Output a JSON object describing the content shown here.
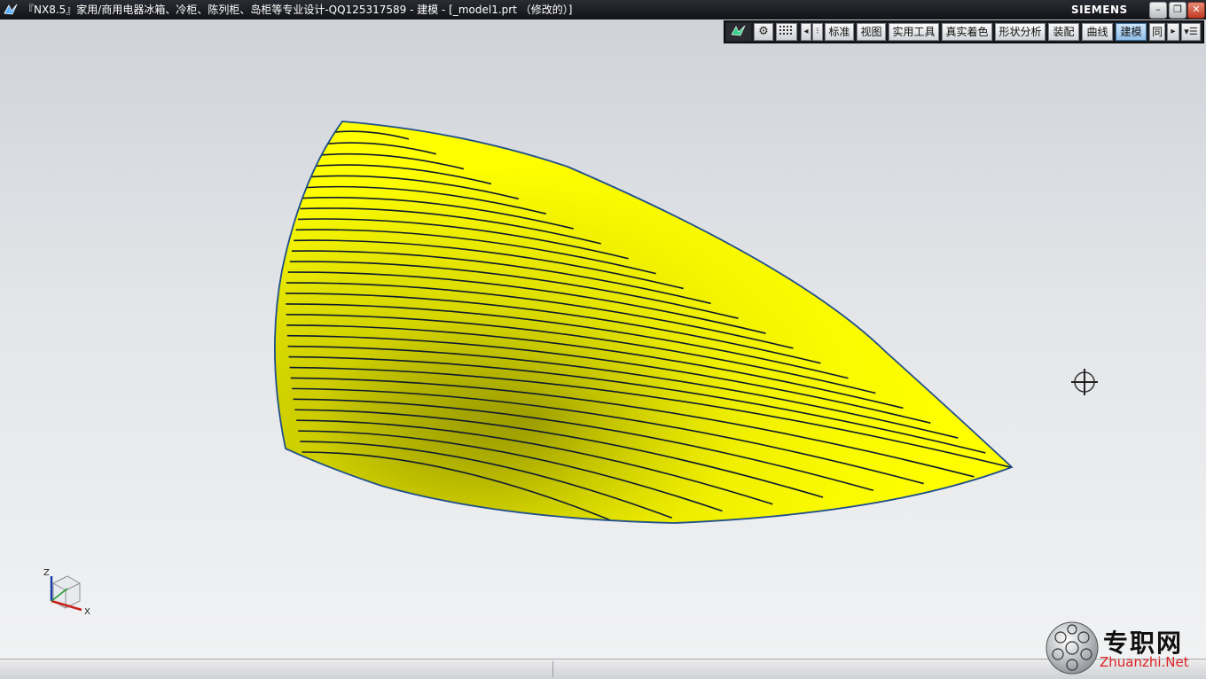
{
  "window": {
    "title": "『NX8.5』家用/商用电器冰箱、冷柜、陈列柜、岛柜等专业设计-QQ125317589 - 建模 - [_model1.prt （修改的）]",
    "brand": "SIEMENS",
    "buttons": {
      "minimize": "–",
      "restore": "❐",
      "close": "✕"
    }
  },
  "toolbar": {
    "icons": [
      "nx-logo-icon",
      "gear-icon",
      "grid-icon",
      "arrow-left-icon"
    ],
    "tabs": [
      {
        "label": "标准"
      },
      {
        "label": "视图"
      },
      {
        "label": "实用工具"
      },
      {
        "label": "真实着色"
      },
      {
        "label": "形状分析"
      },
      {
        "label": "装配"
      },
      {
        "label": "曲线"
      },
      {
        "label": "建模",
        "active": true
      },
      {
        "label": "同"
      }
    ]
  },
  "model": {
    "surface_color": "#ffff00",
    "edge_color": "#1f4f8a",
    "isoline_color": "#0d1a2e"
  },
  "triad": {
    "z": "Z",
    "x": "X"
  },
  "watermark": {
    "cn": "专职网",
    "en": "Zhuanzhi.Net"
  }
}
